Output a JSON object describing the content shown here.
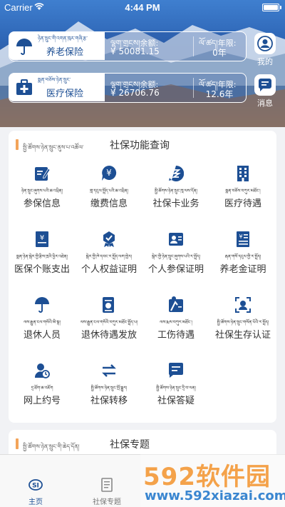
{
  "status_bar": {
    "carrier": "Carrier",
    "time": "4:44 PM"
  },
  "cards": [
    {
      "tibetan": "ཉེན་སྲུང་གི་འགན་ཁུར་གཞི་རྩ་",
      "name": "养老保险",
      "balance_label": "ལྷག་གྲངས།余额:",
      "balance": "¥ 50081.15",
      "years_label": "ལོ་ཚད།年限:",
      "years": "0年"
    },
    {
      "tibetan": "སྨན་བཅོས་ཉེན་སྲུང་",
      "name": "医疗保险",
      "balance_label": "ལྷག་གྲངས།余额:",
      "balance": "¥ 26706.76",
      "years_label": "ལོ་ཚད།年限:",
      "years": "12.6年"
    }
  ],
  "side_buttons": {
    "mine": "我的",
    "messages": "消息"
  },
  "function_panel": {
    "title_tibetan": "སྤྱི་ཚོགས་ཉེན་སྲུང་ནུས་པ་འཚོལ་",
    "title": "社保功能查询",
    "items": [
      {
        "icon": "edit-document-icon",
        "tibetan": "ཉེན་སྲུང་ཞུགས་པའི་ཆ་འཕྲིན།",
        "label": "参保信息"
      },
      {
        "icon": "yen-payment-icon",
        "tibetan": "གླ་དངུལ་སྤྲོད་པའི་ཆ་འཕྲིན།",
        "label": "缴费信息"
      },
      {
        "icon": "card-service-icon",
        "tibetan": "སྤྱི་ཚོགས་ཉེན་སྲུང་ཁཱ་ལས་དོན།",
        "label": "社保卡业务"
      },
      {
        "icon": "hospital-icon",
        "tibetan": "སྨན་བཅོས་བཀུར་མཐོང་།",
        "label": "医疗待遇"
      },
      {
        "icon": "account-book-icon",
        "tibetan": "སྨན་ཉེན་སྒེར་གྱི་རྩིས་ཁྲའི་ཕྱིར་འཐེན།",
        "label": "医保个账支出"
      },
      {
        "icon": "certificate-icon",
        "tibetan": "སྒེར་གྱི་ཁེ་དབང་ར་སྤྲོད་ལག་ཁྱེར།",
        "label": "个人权益证明"
      },
      {
        "icon": "person-card-icon",
        "tibetan": "སྒེར་གྱི་ཉེན་སྲུང་ཞུགས་པའི་ར་སྤྲོད།",
        "label": "个人参保证明"
      },
      {
        "icon": "pension-document-icon",
        "tibetan": "རྒན་གསོ་དངུལ་གྱི་ར་སྤྲོད།",
        "label": "养老金证明"
      },
      {
        "icon": "umbrella-person-icon",
        "tibetan": "ལས་རྒྱུན་ངལ་གསོའི་མི་སྣ།",
        "label": "退休人员"
      },
      {
        "icon": "retirement-payment-icon",
        "tibetan": "ལས་རྒྱུན་ངལ་གསོའི་བཀུར་མཐོང་སྤྲོད་པ།",
        "label": "退休待遇发放"
      },
      {
        "icon": "work-injury-icon",
        "tibetan": "ལས་རྨས་བཀུར་མཐོང་།",
        "label": "工伤待遇"
      },
      {
        "icon": "face-verify-icon",
        "tibetan": "སྤྱི་ཚོགས་ཉེན་སྲུང་གསོན་པོའི་ར་སྤྲོད།",
        "label": "社保生存认证"
      },
      {
        "icon": "appointment-icon",
        "tibetan": "དྲ་ཐོག་ཆ་འཇོག",
        "label": "网上约号"
      },
      {
        "icon": "transfer-icon",
        "tibetan": "སྤྱི་ཚོགས་ཉེན་སྲུང་སྤོ་སྒྱུར།",
        "label": "社保转移"
      },
      {
        "icon": "qa-chat-icon",
        "tibetan": "སྤྱི་ཚོགས་ཉེན་སྲུང་དྲི་བ་ལན།",
        "label": "社保答疑"
      }
    ]
  },
  "topic_panel": {
    "title_tibetan": "སྤྱི་ཚོགས་ཉེན་སྲུང་གི་ཆེད་དོན།",
    "title": "社保专题"
  },
  "tabbar": {
    "home": "主页",
    "topics": "社保专题"
  },
  "watermark": {
    "brand": "592软件园",
    "site": "www.592xiazai.com"
  },
  "colors": {
    "primary": "#1d4f94",
    "accent": "#f3a45a"
  }
}
